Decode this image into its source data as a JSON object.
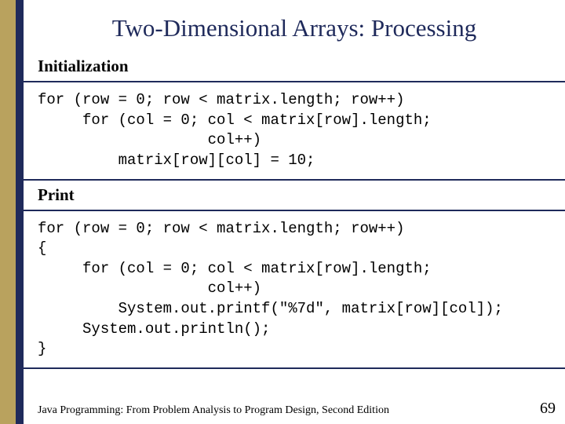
{
  "title": "Two-Dimensional Arrays: Processing",
  "sections": {
    "init": {
      "label": "Initialization",
      "code": "for (row = 0; row < matrix.length; row++)\n     for (col = 0; col < matrix[row].length;\n                   col++)\n         matrix[row][col] = 10;"
    },
    "print": {
      "label": "Print",
      "code": "for (row = 0; row < matrix.length; row++)\n{\n     for (col = 0; col < matrix[row].length;\n                   col++)\n         System.out.printf(\"%7d\", matrix[row][col]);\n     System.out.println();\n}"
    }
  },
  "footer": {
    "book": "Java Programming: From Problem Analysis to Program Design, Second Edition",
    "page": "69"
  }
}
